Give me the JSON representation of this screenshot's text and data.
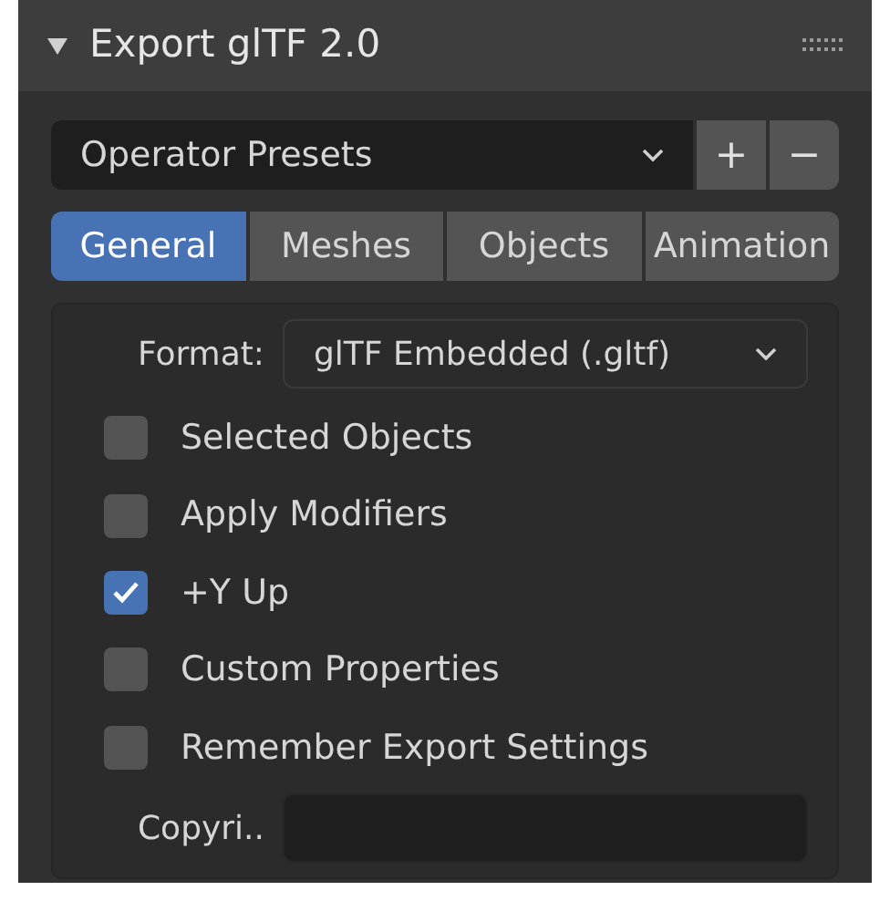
{
  "panel": {
    "title": "Export glTF 2.0",
    "expanded": true
  },
  "presets": {
    "value": "Operator Presets",
    "buttons": [
      "+",
      "−"
    ]
  },
  "tabs": [
    {
      "label": "General",
      "selected": true
    },
    {
      "label": "Meshes",
      "selected": false
    },
    {
      "label": "Objects",
      "selected": false
    },
    {
      "label": "Animation",
      "selected": false
    }
  ],
  "format": {
    "label": "Format:",
    "value": "glTF Embedded (.gltf)"
  },
  "options": [
    {
      "label": "Selected Objects",
      "checked": false
    },
    {
      "label": "Apply Modifiers",
      "checked": false
    },
    {
      "label": "+Y Up",
      "checked": true
    },
    {
      "label": "Custom Properties",
      "checked": false
    },
    {
      "label": "Remember Export Settings",
      "checked": false
    }
  ],
  "copyright": {
    "label": "Copyri.."
  }
}
